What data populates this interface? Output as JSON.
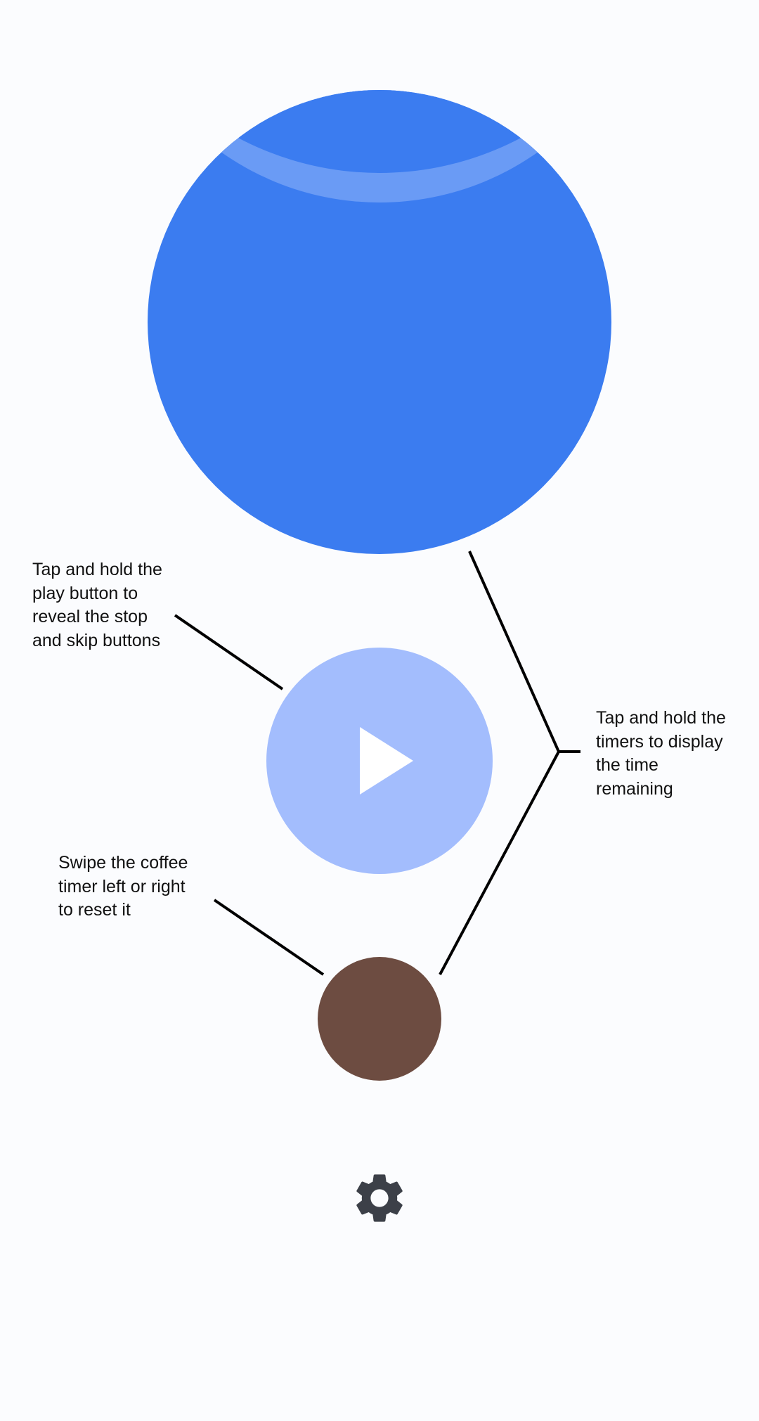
{
  "hints": {
    "play": [
      "Tap and hold the",
      "play button to",
      "reveal the stop",
      "and skip buttons"
    ],
    "coffee": [
      "Swipe the coffee",
      "timer left or right",
      "to reset it"
    ],
    "timers": [
      "Tap and hold the",
      "timers to display",
      "the time",
      "remaining"
    ]
  },
  "main_timer": {
    "color": "#3b7cf0",
    "remaining_color": "#6a9bf5"
  },
  "play_button": {
    "icon": "play-icon",
    "color": "#a3bdfd"
  },
  "coffee_timer": {
    "color": "#6d4c41"
  },
  "settings": {
    "icon": "gear-icon",
    "color": "#3c4048"
  }
}
